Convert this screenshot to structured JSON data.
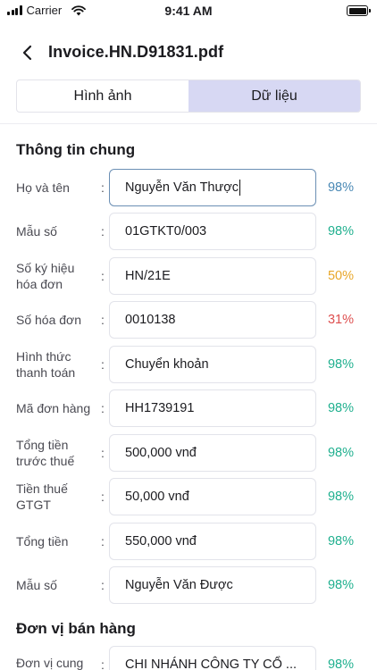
{
  "status_bar": {
    "carrier": "Carrier",
    "time": "9:41 AM"
  },
  "header": {
    "title": "Invoice.HN.D91831.pdf",
    "back_icon": "chevron-left-icon"
  },
  "tabs": [
    {
      "label": "Hình ảnh",
      "active": false
    },
    {
      "label": "Dữ liệu",
      "active": true
    }
  ],
  "sections": {
    "general": {
      "title": "Thông tin chung"
    },
    "seller": {
      "title": "Đơn vị bán hàng"
    }
  },
  "colon": ":",
  "fields": [
    {
      "label": "Họ và tên",
      "value": "Nguyễn Văn Thược",
      "confidence": "98%",
      "level": "blue",
      "focused": true
    },
    {
      "label": "Mẫu số",
      "value": "01GTKT0/003",
      "confidence": "98%",
      "level": "green"
    },
    {
      "label": "Số ký hiệu hóa đơn",
      "value": "HN/21E",
      "confidence": "50%",
      "level": "orange"
    },
    {
      "label": "Số hóa đơn",
      "value": "0010138",
      "confidence": "31%",
      "level": "red"
    },
    {
      "label": "Hình thức thanh toán",
      "value": "Chuyển khoản",
      "confidence": "98%",
      "level": "green"
    },
    {
      "label": "Mã đơn hàng",
      "value": "HH1739191",
      "confidence": "98%",
      "level": "green"
    },
    {
      "label": "Tổng tiền trước thuế",
      "value": "500,000 vnđ",
      "confidence": "98%",
      "level": "green"
    },
    {
      "label": "Tiền thuế GTGT",
      "value": "50,000 vnđ",
      "confidence": "98%",
      "level": "green"
    },
    {
      "label": "Tổng tiền",
      "value": "550,000 vnđ",
      "confidence": "98%",
      "level": "green"
    },
    {
      "label": "Mẫu số",
      "value": "Nguyễn Văn Được",
      "confidence": "98%",
      "level": "green"
    }
  ],
  "seller_fields": [
    {
      "label": "Đơn vị cung cấp",
      "value": "CHI NHÁNH CÔNG TY CỔ ...",
      "confidence": "98%",
      "level": "green"
    }
  ],
  "colors": {
    "accent_tab": "#d7d8f3",
    "focus_border": "#6b8fb4",
    "high": "#20b08f",
    "medium": "#e8a72a",
    "low": "#de5050"
  }
}
